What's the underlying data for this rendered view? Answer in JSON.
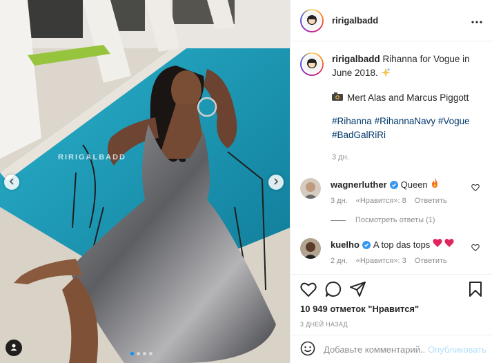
{
  "photo": {
    "watermark": "RIRIGALBADD",
    "slide_count": 4,
    "active_slide": 1
  },
  "header": {
    "username": "ririgalbadd",
    "more_icon": "more-horizontal-icon"
  },
  "caption": {
    "username": "ririgalbadd",
    "text": "Rihanna for Vogue in June 2018.",
    "emoji": "sparkle-emoji",
    "credit_icon": "camera-emoji",
    "credit": "Mert Alas and Marcus Piggott",
    "hashtags": [
      "#Rihanna",
      "#RihannaNavy",
      "#Vogue",
      "#BadGalRiRi"
    ],
    "time": "3 дн."
  },
  "comments": [
    {
      "username": "wagnerluther",
      "verified": true,
      "text": "Queen",
      "emoji": "fire-emoji",
      "time": "3 дн.",
      "likes": "«Нравится»: 8",
      "reply": "Ответить",
      "view_replies": "Посмотреть ответы (1)"
    },
    {
      "username": "kuelho",
      "verified": true,
      "text": "A top das tops",
      "emoji": "two-red-hearts-emoji",
      "time": "2 дн.",
      "likes": "«Нравится»: 3",
      "reply": "Ответить"
    }
  ],
  "actions": {
    "likes_text": "10 949 отметок \"Нравится\"",
    "post_date": "3 ДНЕЙ НАЗАД"
  },
  "add_comment": {
    "placeholder": "Добавьте комментарий...",
    "publish": "Опубликовать"
  },
  "colors": {
    "link": "#00376b",
    "verified": "#3897f0",
    "publish_disabled": "#b2dffc",
    "muted": "#8e8e8e",
    "pool": "#1b93b0"
  }
}
